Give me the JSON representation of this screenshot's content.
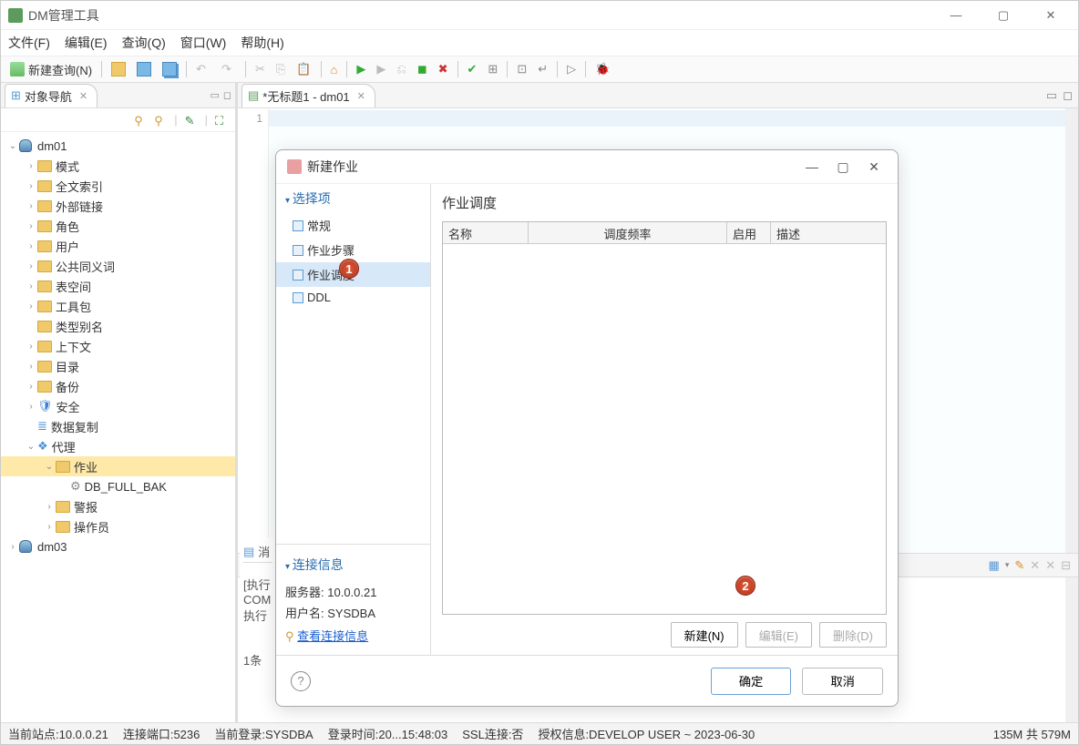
{
  "app_title": "DM管理工具",
  "menus": [
    "文件(F)",
    "编辑(E)",
    "查询(Q)",
    "窗口(W)",
    "帮助(H)"
  ],
  "toolbar_new_query": "新建查询(N)",
  "sidebar": {
    "title": "对象导航",
    "root1": "dm01",
    "items": [
      "模式",
      "全文索引",
      "外部链接",
      "角色",
      "用户",
      "公共同义词",
      "表空间",
      "工具包",
      "类型别名",
      "上下文",
      "目录",
      "备份",
      "安全",
      "数据复制",
      "代理"
    ],
    "agent_children": {
      "job": "作业",
      "job_child": "DB_FULL_BAK",
      "alert": "警报",
      "operator": "操作员"
    },
    "root2": "dm03"
  },
  "editor_tab": "*无标题1 - dm01",
  "line_num": "1",
  "dialog": {
    "title": "新建作业",
    "left_section": "选择项",
    "nav": [
      "常规",
      "作业步骤",
      "作业调度",
      "DDL"
    ],
    "selected_nav": "作业调度",
    "conn_section": "连接信息",
    "conn_server_label": "服务器:",
    "conn_server": "10.0.0.21",
    "conn_user_label": "用户名:",
    "conn_user": "SYSDBA",
    "conn_link": "查看连接信息",
    "heading": "作业调度",
    "columns": {
      "name": "名称",
      "freq": "调度频率",
      "enable": "启用",
      "desc": "描述"
    },
    "action_new": "新建(N)",
    "action_edit": "编辑(E)",
    "action_delete": "删除(D)",
    "ok": "确定",
    "cancel": "取消"
  },
  "msg_tab": "消",
  "msg_lines": [
    "[执行",
    "COM",
    "执行",
    "",
    "1条"
  ],
  "status": {
    "site": "当前站点:10.0.0.21",
    "port": "连接端口:5236",
    "login": "当前登录:SYSDBA",
    "time": "登录时间:20...15:48:03",
    "ssl": "SSL连接:否",
    "auth": "授权信息:DEVELOP USER ~ 2023-06-30",
    "mem": "135M 共 579M"
  },
  "bubbles": {
    "one": "1",
    "two": "2"
  }
}
